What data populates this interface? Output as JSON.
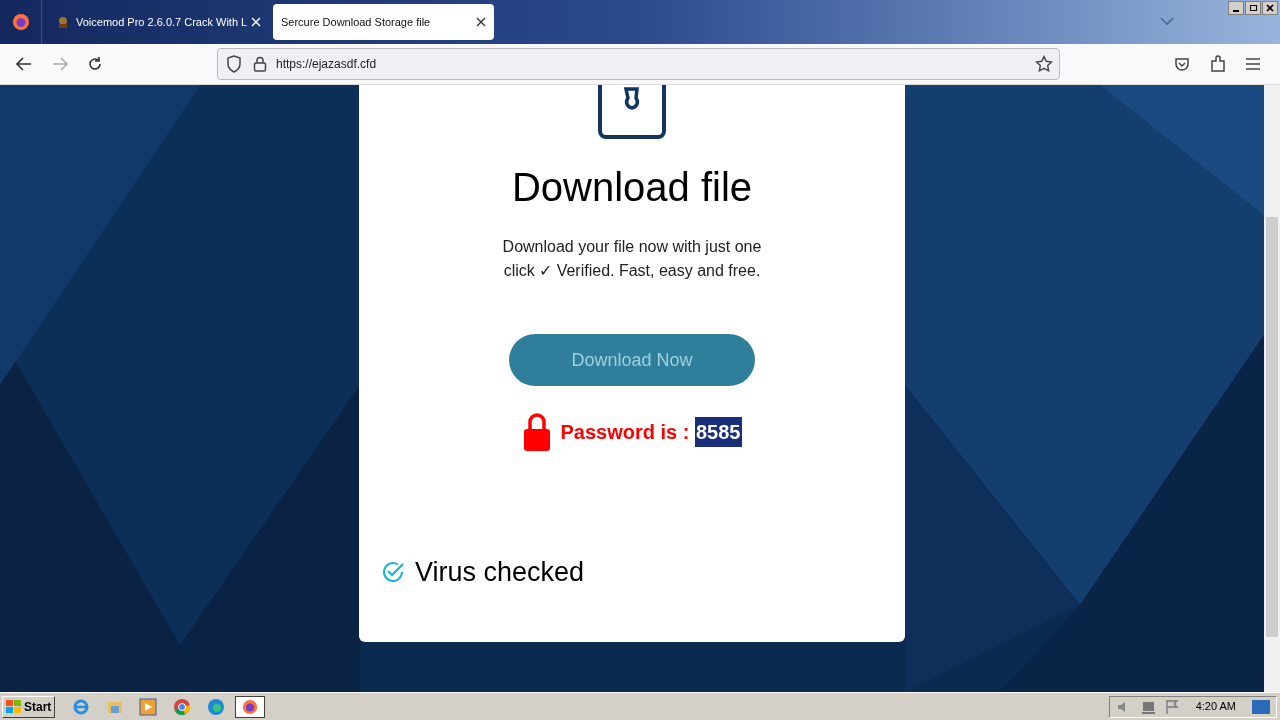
{
  "browser": {
    "tabs": [
      {
        "title": "Voicemod Pro 2.6.0.7 Crack With L",
        "selected": false
      },
      {
        "title": "Sercure Download Storage file",
        "selected": true
      }
    ],
    "url": "https://ejazasdf.cfd"
  },
  "page": {
    "heading": "Download file",
    "description": "Download your file now with just one click ✓ Verified. Fast, easy and free.",
    "button": "Download Now",
    "password_label": "Password is : ",
    "password": "8585",
    "virus_label": "Virus checked"
  },
  "taskbar": {
    "start": "Start",
    "clock": "4:20 AM"
  }
}
